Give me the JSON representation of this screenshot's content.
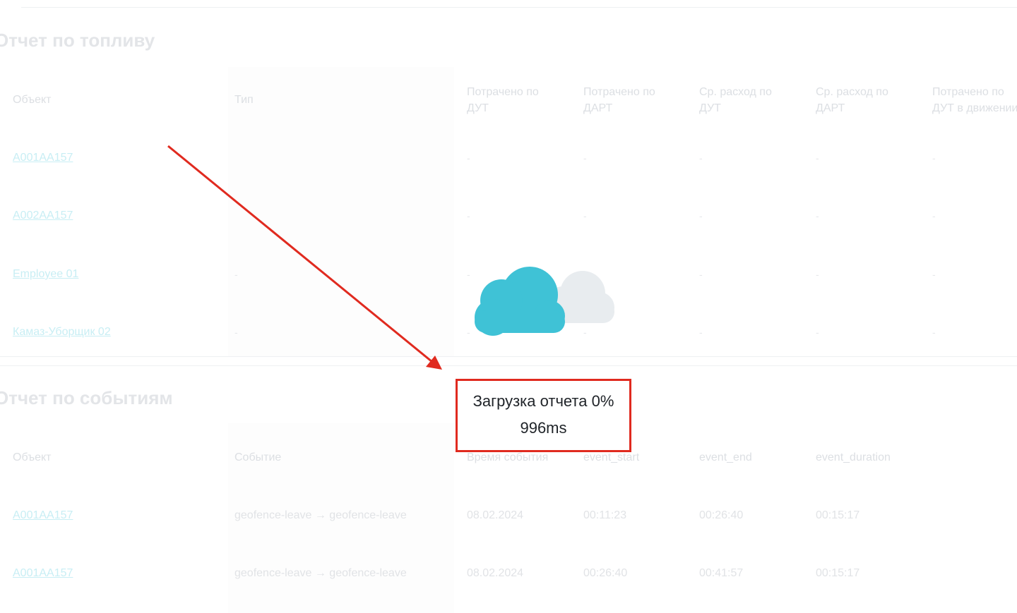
{
  "fuel_report": {
    "title": "Отчет по топливу",
    "columns": [
      "Объект",
      "Тип",
      "Потрачено по ДУТ",
      "Потрачено по ДАРТ",
      "Ср. расход по ДУТ",
      "Ср. расход по ДАРТ",
      "Потрачено по ДУТ в движении"
    ],
    "rows": [
      {
        "object": "A001AA157",
        "type": "",
        "values": [
          "-",
          "-",
          "-",
          "-",
          "-"
        ]
      },
      {
        "object": "A002AA157",
        "type": "",
        "values": [
          "-",
          "-",
          "-",
          "-",
          "-"
        ]
      },
      {
        "object": "Employee 01",
        "type": "-",
        "values": [
          "-",
          "-",
          "-",
          "-",
          "-"
        ]
      },
      {
        "object": "Камаз-Уборщик 02",
        "type": "-",
        "values": [
          "-",
          "-",
          "-",
          "-",
          "-"
        ]
      }
    ]
  },
  "events_report": {
    "title": "Отчет по событиям",
    "columns": [
      "Объект",
      "Событие",
      "Время события",
      "event_start",
      "event_end",
      "event_duration"
    ],
    "rows": [
      {
        "object": "A001AA157",
        "event": "geofence-leave → geofence-leave",
        "time": "08.02.2024",
        "start": "00:11:23",
        "end": "00:26:40",
        "duration": "00:15:17"
      },
      {
        "object": "A001AA157",
        "event": "geofence-leave → geofence-leave",
        "time": "08.02.2024",
        "start": "00:26:40",
        "end": "00:41:57",
        "duration": "00:15:17"
      }
    ]
  },
  "loading": {
    "progress_text": "Загрузка отчета 0%",
    "elapsed": "996ms",
    "icon": "cloud-icon"
  },
  "colors": {
    "highlight": "#e02a1f",
    "cloud_primary": "#3fc2d6",
    "cloud_secondary": "#e8ecef"
  }
}
